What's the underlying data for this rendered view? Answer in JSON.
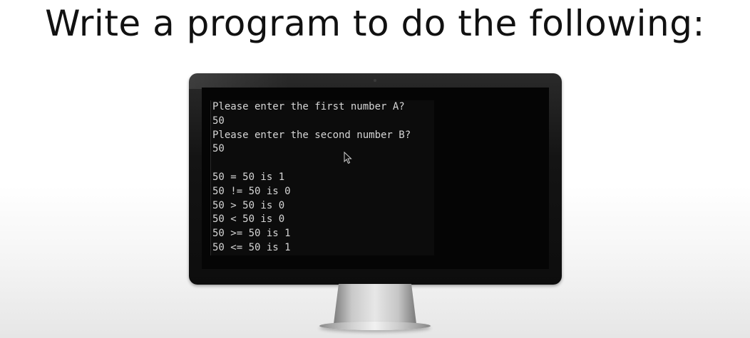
{
  "slide": {
    "title": "Write a program to do the following:"
  },
  "console": {
    "lines": [
      "Please enter the first number A?",
      "50",
      "Please enter the second number B?",
      "50",
      "",
      "50 = 50 is 1",
      "50 != 50 is 0",
      "50 > 50 is 0",
      "50 < 50 is 0",
      "50 >= 50 is 1",
      "50 <= 50 is 1"
    ]
  },
  "icons": {
    "cursor": "mouse-pointer-icon"
  },
  "colors": {
    "console_background": "#0c0c0c",
    "console_text": "#d6d6d6",
    "monitor_bezel": "#141414"
  }
}
